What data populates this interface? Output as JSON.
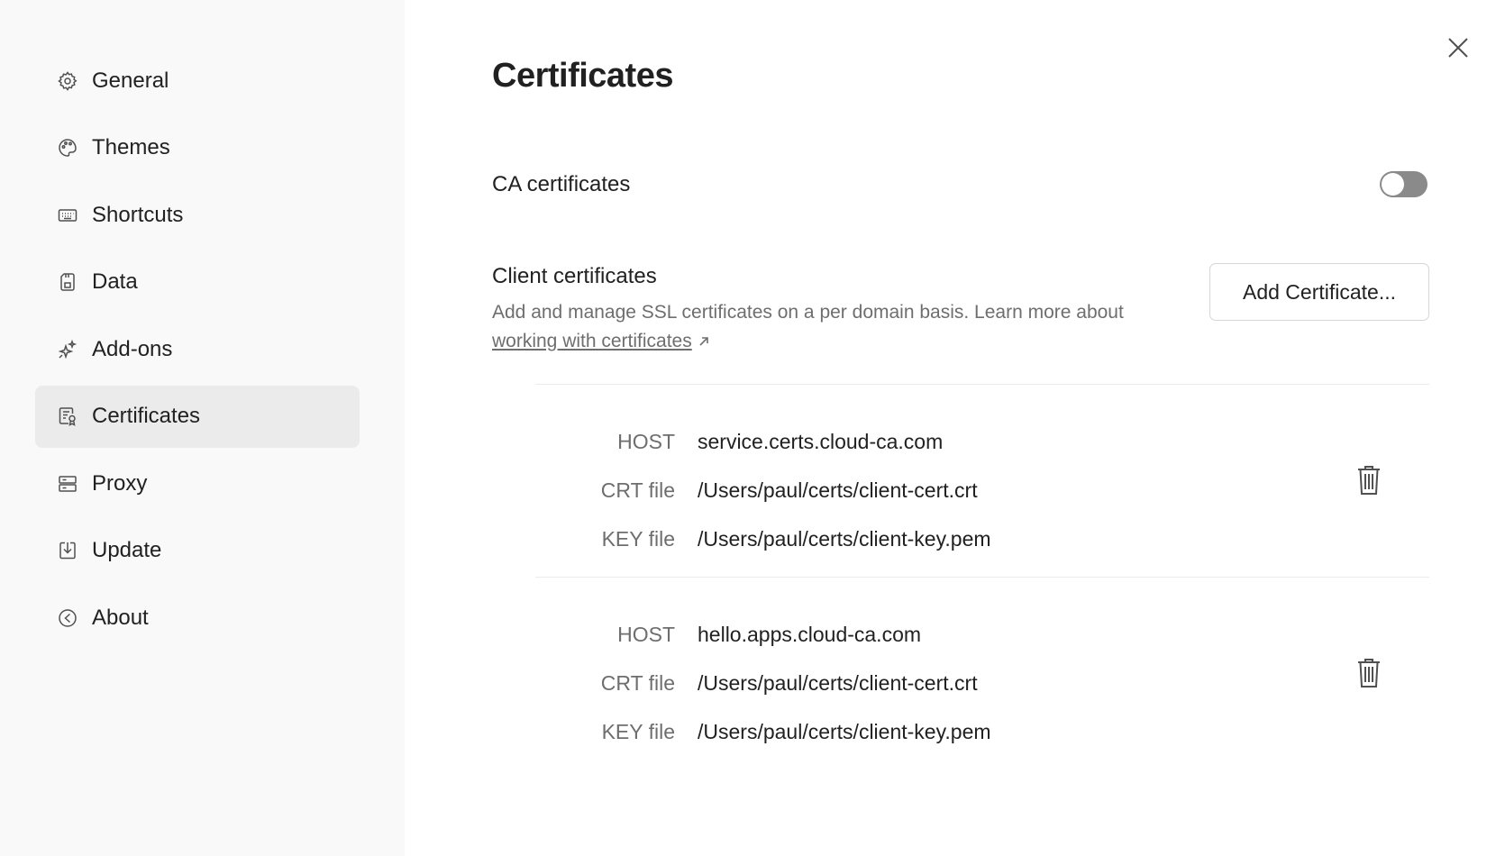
{
  "sidebar": {
    "items": [
      {
        "label": "General",
        "icon": "gear-icon",
        "active": false
      },
      {
        "label": "Themes",
        "icon": "palette-icon",
        "active": false
      },
      {
        "label": "Shortcuts",
        "icon": "keyboard-icon",
        "active": false
      },
      {
        "label": "Data",
        "icon": "save-icon",
        "active": false
      },
      {
        "label": "Add-ons",
        "icon": "sparkles-icon",
        "active": false
      },
      {
        "label": "Certificates",
        "icon": "certificate-icon",
        "active": true
      },
      {
        "label": "Proxy",
        "icon": "server-icon",
        "active": false
      },
      {
        "label": "Update",
        "icon": "download-icon",
        "active": false
      },
      {
        "label": "About",
        "icon": "info-icon",
        "active": false
      }
    ]
  },
  "main": {
    "title": "Certificates",
    "ca": {
      "label": "CA certificates",
      "enabled": false
    },
    "client": {
      "title": "Client certificates",
      "description": "Add and manage SSL certificates on a per domain basis. Learn more about ",
      "link_text": "working with certificates",
      "add_button": "Add Certificate..."
    },
    "labels": {
      "host": "HOST",
      "crt": "CRT file",
      "key": "KEY file"
    },
    "certificates": [
      {
        "host": "service.certs.cloud-ca.com",
        "crt": "/Users/paul/certs/client-cert.crt",
        "key": "/Users/paul/certs/client-key.pem"
      },
      {
        "host": "hello.apps.cloud-ca.com",
        "crt": "/Users/paul/certs/client-cert.crt",
        "key": "/Users/paul/certs/client-key.pem"
      }
    ]
  },
  "colors": {
    "sidebar_bg": "#f9f9f9",
    "active_item_bg": "#ebebeb",
    "toggle_off": "#8a8a8a",
    "text_primary": "#212121",
    "text_secondary": "#6e6e6e"
  }
}
